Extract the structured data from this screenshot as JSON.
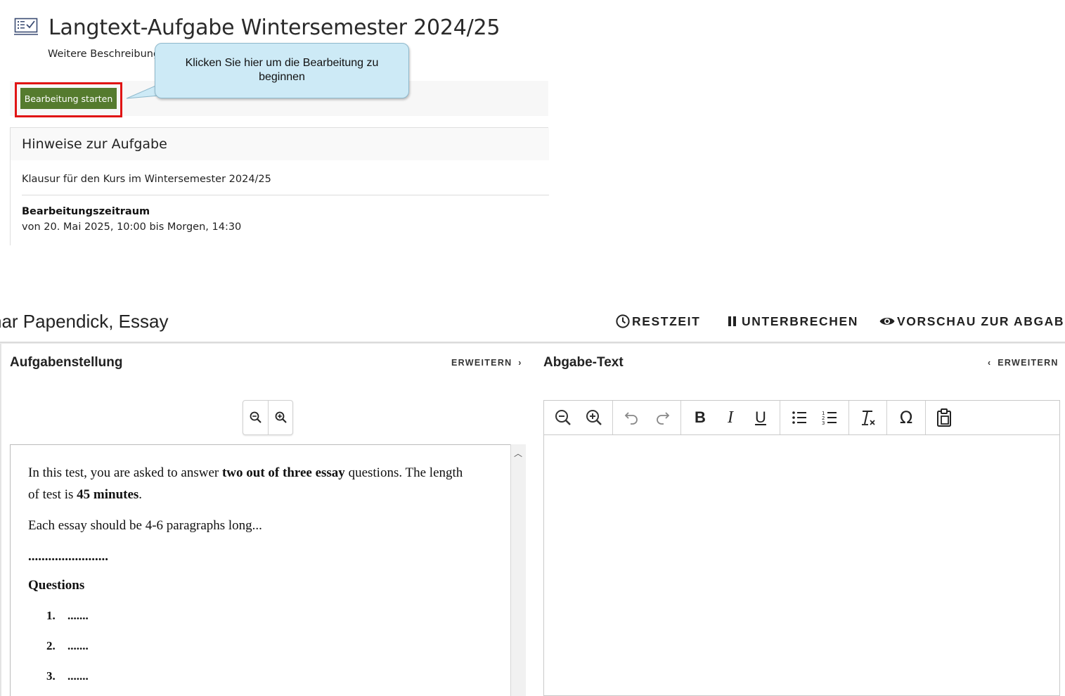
{
  "test_info": {
    "icon": "test-checklist-icon",
    "title": "Langtext-Aufgabe Wintersemester 2024/25",
    "subtitle": "Weitere Beschreibung",
    "start_button": "Bearbeitung starten",
    "callout": "Klicken Sie hier um die Bearbeitung zu beginnen",
    "hints": {
      "title": "Hinweise zur Aufgabe",
      "description": "Klausur für den Kurs im Wintersemester 2024/25",
      "period_label": "Bearbeitungszeitraum",
      "period_value": "von 20. Mai 2025, 10:00 bis Morgen, 14:30"
    }
  },
  "player": {
    "title": "nar Papendick, Essay",
    "actions": {
      "remaining_time": "RESTZEIT",
      "pause": "UNTERBRECHEN",
      "preview": "VORSCHAU ZUR ABGABE"
    },
    "task_pane": {
      "title": "Aufgabenstellung",
      "expand": "ERWEITERN",
      "zoom_out_icon": "zoom-out-icon",
      "zoom_in_icon": "zoom-in-icon",
      "question": {
        "p1_a": "In this test, you are asked to answer ",
        "p1_b": "two out of three essay",
        "p1_c": " questions. The length",
        "p1_d": "of test is ",
        "p1_e": "45 minutes",
        "p1_f": ".",
        "p2": "Each essay should be 4-6 paragraphs long...",
        "separator": "........................",
        "heading": "Questions",
        "items": [
          {
            "num": "1.",
            "text": "......."
          },
          {
            "num": "2.",
            "text": "......."
          },
          {
            "num": "3.",
            "text": "......."
          }
        ]
      }
    },
    "answer_pane": {
      "title": "Abgabe-Text",
      "expand": "ERWEITERN",
      "toolbar": [
        "zoom-out-icon",
        "zoom-in-icon",
        "undo-icon",
        "redo-icon",
        "bold-icon",
        "italic-icon",
        "underline-icon",
        "bullet-list-icon",
        "numbered-list-icon",
        "clear-format-icon",
        "special-char-icon",
        "paste-icon"
      ]
    }
  }
}
